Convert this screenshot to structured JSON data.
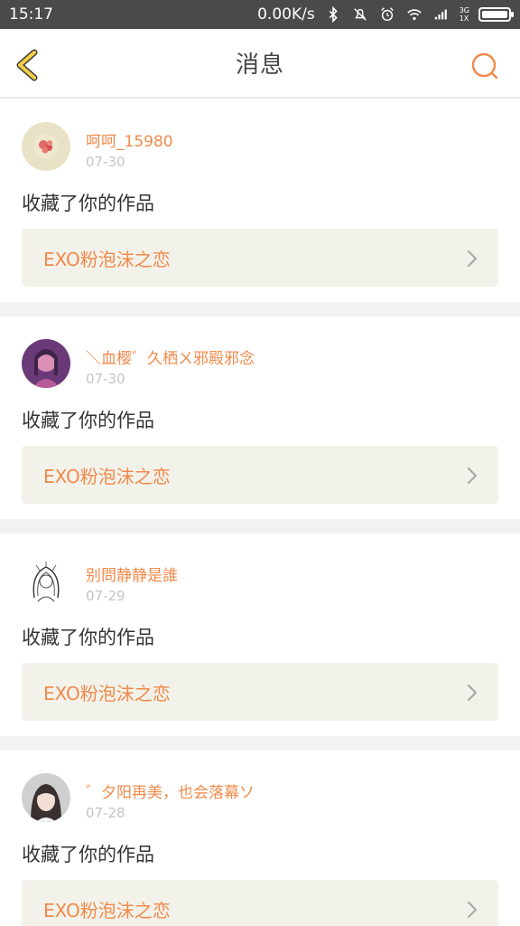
{
  "status_bar": {
    "time": "15:17",
    "speed": "0.00K/s",
    "network": "3G",
    "sim": "1X"
  },
  "header": {
    "title": "消息",
    "back_icon": "back-chevron-icon",
    "search_icon": "search-icon"
  },
  "colors": {
    "accent": "#f08a4b",
    "back_icon": "#f5cf45",
    "work_box_bg": "#f3f2ea"
  },
  "messages": [
    {
      "username": "呵呵_15980",
      "date": "07-30",
      "action": "收藏了你的作品",
      "work_title": "EXO粉泡沫之恋"
    },
    {
      "username": "＼血樱゛久栖ㄨ邪殿邪念",
      "date": "07-30",
      "action": "收藏了你的作品",
      "work_title": "EXO粉泡沫之恋"
    },
    {
      "username": "别問静静是誰",
      "date": "07-29",
      "action": "收藏了你的作品",
      "work_title": "EXO粉泡沫之恋"
    },
    {
      "username": "゛夕阳再美，也会落幕ソ",
      "date": "07-28",
      "action": "收藏了你的作品",
      "work_title": "EXO粉泡沫之恋"
    }
  ]
}
